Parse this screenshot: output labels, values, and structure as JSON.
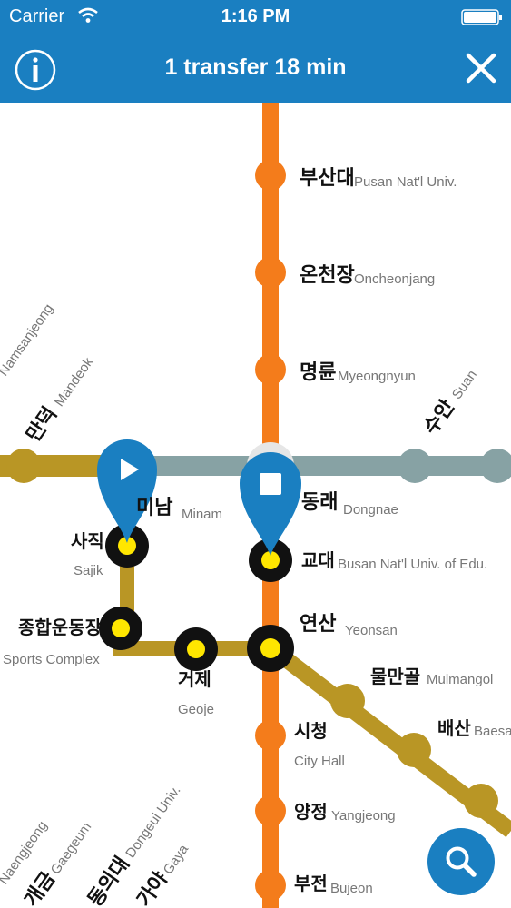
{
  "status_bar": {
    "carrier": "Carrier",
    "time": "1:16 PM"
  },
  "nav": {
    "title": "1 transfer 18 min",
    "info_icon": "info-icon",
    "close_icon": "close-icon"
  },
  "colors": {
    "header": "#1a7fc1",
    "line1": "#f47c1b",
    "line2": "#b99625",
    "line3": "#87a2a4",
    "route_dot": "#ffe600"
  },
  "stations": {
    "pusan_natl": {
      "kr": "부산대",
      "en": "Pusan Nat'l Univ."
    },
    "oncheonjang": {
      "kr": "온천장",
      "en": "Oncheonjang"
    },
    "myeongnyun": {
      "kr": "명륜",
      "en": "Myeongnyun"
    },
    "suan": {
      "kr": "수안",
      "en": "Suan"
    },
    "mandeok": {
      "kr": "만덕",
      "en": "Mandeok"
    },
    "namsanjeong": {
      "en": "Namsanjeong"
    },
    "minam": {
      "kr": "미남",
      "en": "Minam"
    },
    "dongnae": {
      "kr": "동래",
      "en": "Dongnae"
    },
    "sajik": {
      "kr": "사직",
      "en": "Sajik"
    },
    "gyodae": {
      "kr": "교대",
      "en": "Busan Nat'l Univ. of Edu."
    },
    "sports": {
      "kr": "종합운동장",
      "en": "Sports Complex"
    },
    "yeonsan": {
      "kr": "연산",
      "en": "Yeonsan"
    },
    "geoje": {
      "kr": "거제",
      "en": "Geoje"
    },
    "mulmangol": {
      "kr": "물만골",
      "en": "Mulmangol"
    },
    "baesan": {
      "kr": "배산",
      "en": "Baesan"
    },
    "cityhall": {
      "kr": "시청",
      "en": "City Hall"
    },
    "yangjeong": {
      "kr": "양정",
      "en": "Yangjeong"
    },
    "bujeon": {
      "kr": "부전",
      "en": "Bujeon"
    },
    "dongeui": {
      "kr": "동의대",
      "en": "Dongeui Univ."
    },
    "gaya": {
      "kr": "가야",
      "en": "Gaya"
    },
    "gaegeum": {
      "kr": "개금",
      "en": "Gaegeum"
    },
    "naengjeong": {
      "en": "Naengjeong"
    }
  },
  "search_icon": "search-icon"
}
